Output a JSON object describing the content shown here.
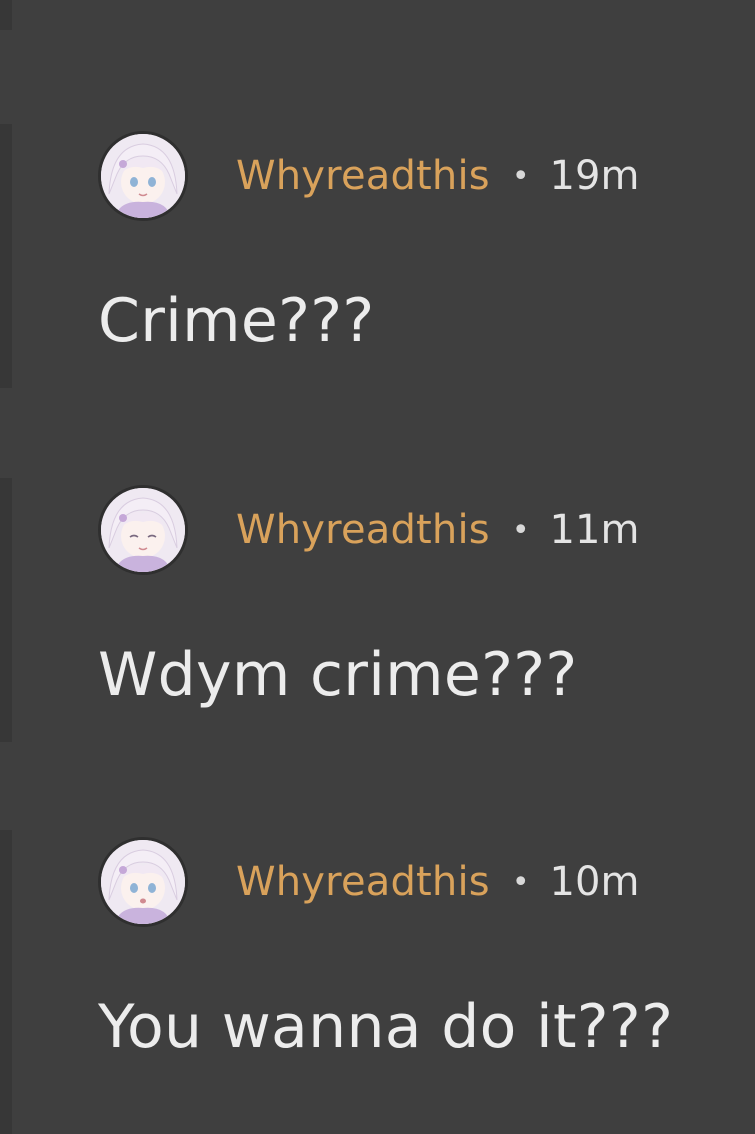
{
  "comments": [
    {
      "author": "Whyreadthis",
      "separator": "•",
      "time": "19m",
      "text": "Crime???",
      "avatar_icon": "anime-girl-avatar"
    },
    {
      "author": "Whyreadthis",
      "separator": "•",
      "time": "11m",
      "text": "Wdym crime???",
      "avatar_icon": "anime-girl-avatar"
    },
    {
      "author": "Whyreadthis",
      "separator": "•",
      "time": "10m",
      "text": "You wanna do it???",
      "avatar_icon": "anime-girl-avatar"
    }
  ],
  "colors": {
    "background": "#3f3f3f",
    "username": "#d9a25b",
    "text": "#ececec"
  }
}
